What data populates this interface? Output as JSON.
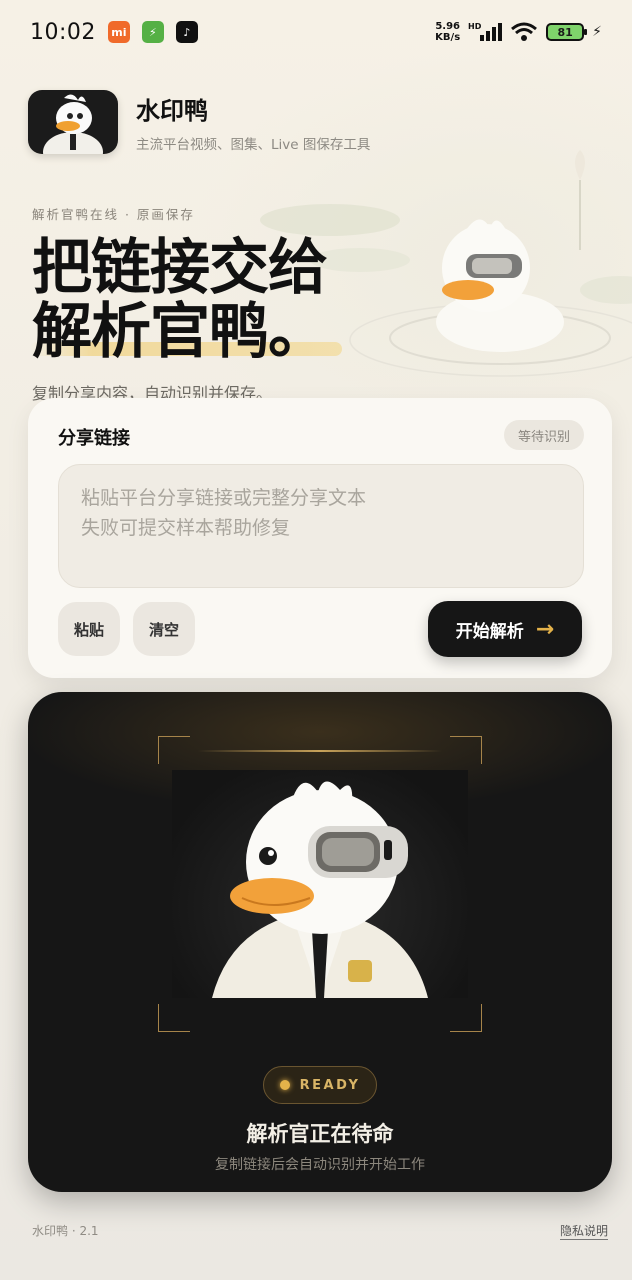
{
  "status_bar": {
    "time": "10:02",
    "speed_value": "5.96",
    "speed_unit": "KB/s",
    "signal_label": "HD",
    "battery": "81"
  },
  "header": {
    "app_name": "水印鸭",
    "app_subtitle": "主流平台视频、图集、Live 图保存工具"
  },
  "hero": {
    "eyebrow": "解析官鸭在线 · 原画保存",
    "title_line1": "把链接交给",
    "title_line2": "解析官鸭。",
    "description": "复制分享内容，自动识别并保存。"
  },
  "share_card": {
    "title": "分享链接",
    "status_badge": "等待识别",
    "input_placeholder": "粘贴平台分享链接或完整分享文本\n失败可提交样本帮助修复",
    "paste_label": "粘贴",
    "clear_label": "清空",
    "start_label": "开始解析"
  },
  "ready_card": {
    "badge": "READY",
    "title": "解析官正在待命",
    "description": "复制链接后会自动识别并开始工作"
  },
  "footer": {
    "version": "水印鸭 · 2.1",
    "privacy_link": "隐私说明"
  },
  "colors": {
    "accent": "#e4b24a",
    "dark_card": "#161616",
    "page_bg": "#f3efe6"
  }
}
